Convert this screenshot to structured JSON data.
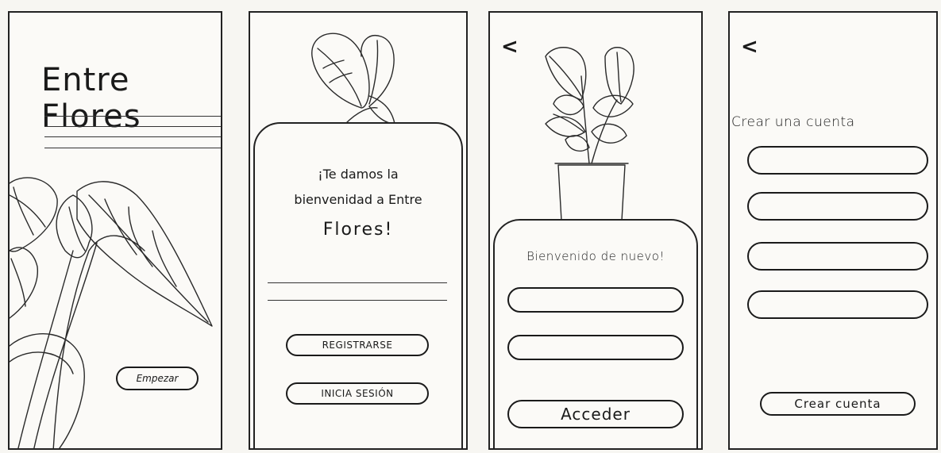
{
  "screens": {
    "splash": {
      "title": "Entre Flores",
      "start_button": "Empezar"
    },
    "welcome": {
      "heading_line1": "¡Te damos la",
      "heading_line2": "bienvenidad a Entre",
      "heading_line3": "Flores!",
      "register_button": "REGISTRARSE",
      "login_button": "INICIA SESIÓN"
    },
    "login": {
      "back": "<",
      "heading": "Bienvenido de nuevo!",
      "submit_button": "Acceder"
    },
    "signup": {
      "back": "<",
      "heading": "Crear una cuenta",
      "submit_button": "Crear cuenta"
    }
  },
  "icons": {
    "back": "chevron-left-icon",
    "plant_leaves": "plant-leaves-illustration",
    "potted_plant": "potted-plant-illustration",
    "caladium": "caladium-plant-illustration"
  }
}
